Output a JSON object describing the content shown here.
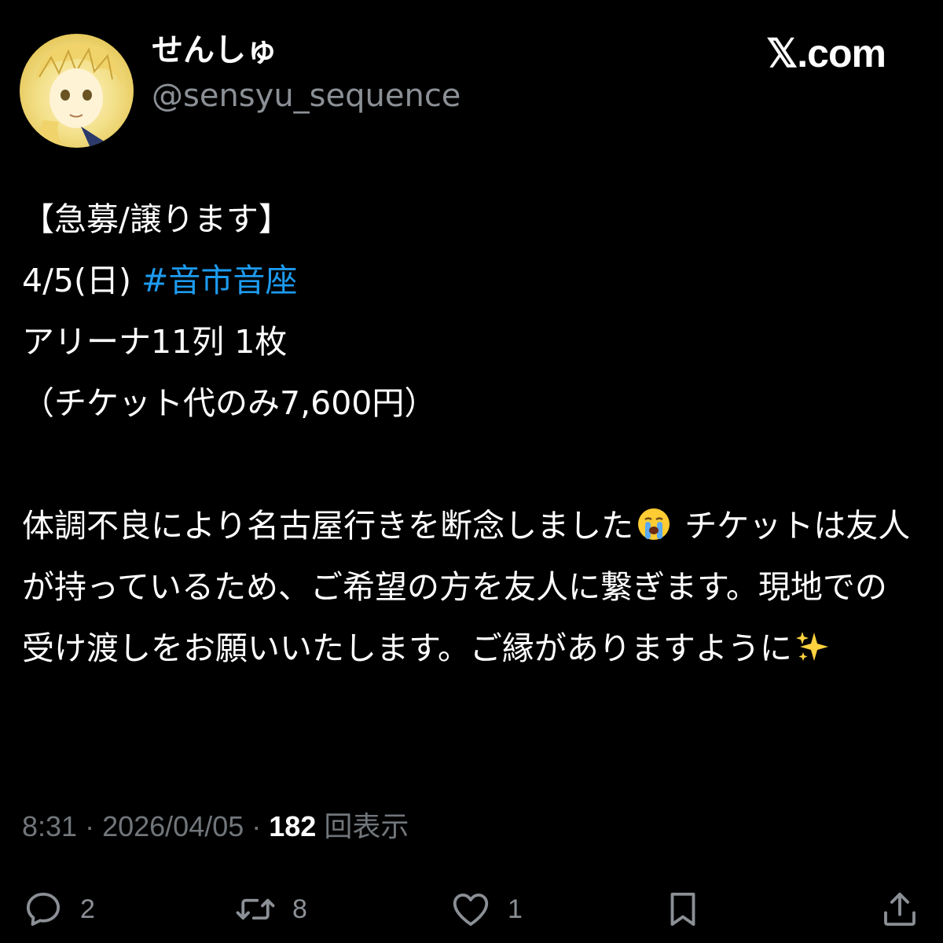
{
  "author": {
    "display_name": "せんしゅ",
    "handle": "@sensyu_sequence"
  },
  "site_logo": "𝕏.com",
  "post": {
    "lines": [
      "【急募/譲ります】",
      "4/5(日) ",
      "アリーナ11列 1枚",
      "（チケット代のみ7,600円）"
    ],
    "hashtag": "#音市音座",
    "paragraph_part1": "体調不良により名古屋行きを断念しました",
    "paragraph_part2": " チケットは友人が持っているため、ご希望の方を友人に繋ぎます。現地での受け渡しをお願いいたします。ご縁がありますように",
    "emojis": [
      "crying-face",
      "sparkles"
    ]
  },
  "meta": {
    "time": "8:31",
    "separator": " · ",
    "date": "2026/04/05",
    "views_count": "182",
    "views_label": " 回表示"
  },
  "actions": {
    "reply_count": "2",
    "repost_count": "8",
    "like_count": "1"
  },
  "colors": {
    "background": "#000000",
    "text": "#ffffff",
    "secondary": "#71767b",
    "link": "#1d9bf0"
  }
}
